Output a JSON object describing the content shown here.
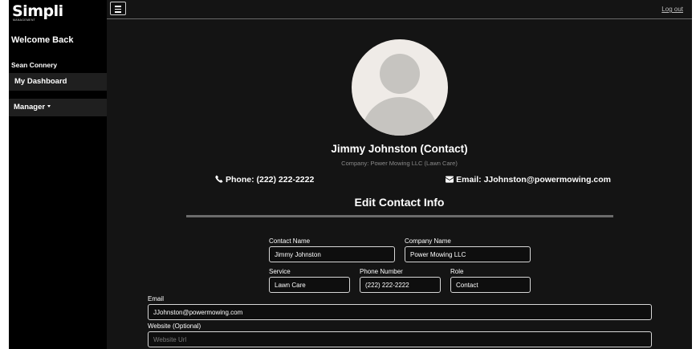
{
  "sidebar": {
    "logo_text": "Simpli",
    "logo_subtext": "MANAGEMENT",
    "welcome": "Welcome Back",
    "username": "Sean Connery",
    "nav": [
      {
        "label": "My Dashboard"
      },
      {
        "label": "Manager"
      }
    ]
  },
  "topbar": {
    "logout_label": "Log out"
  },
  "profile": {
    "name": "Jimmy Johnston (Contact)",
    "company_line": "Company: Power Mowing LLC (Lawn Care)",
    "phone": "Phone: (222) 222-2222",
    "email": "Email: JJohnston@powermowing.com"
  },
  "form": {
    "title": "Edit Contact Info",
    "contact_name": {
      "label": "Contact Name",
      "value": "Jimmy Johnston"
    },
    "company_name": {
      "label": "Company Name",
      "value": "Power Mowing LLC"
    },
    "service": {
      "label": "Service",
      "value": "Lawn Care"
    },
    "phone_number": {
      "label": "Phone Number",
      "value": "(222) 222-2222"
    },
    "role": {
      "label": "Role",
      "value": "Contact"
    },
    "email": {
      "label": "Email",
      "value": "JJohnston@powermowing.com"
    },
    "website": {
      "label": "Website (Optional)",
      "value": "",
      "placeholder": "Website Url"
    }
  },
  "icons": {
    "phone": "phone-icon",
    "email": "envelope-icon",
    "menu": "hamburger-icon",
    "caret": "caret-down-icon"
  },
  "colors": {
    "sidebar_bg": "#000000",
    "main_bg": "#141414",
    "nav_item_bg": "#1f1f1f",
    "avatar_bg": "#efebe7",
    "avatar_fg": "#c6c4c0",
    "divider": "#6b6b6b"
  }
}
